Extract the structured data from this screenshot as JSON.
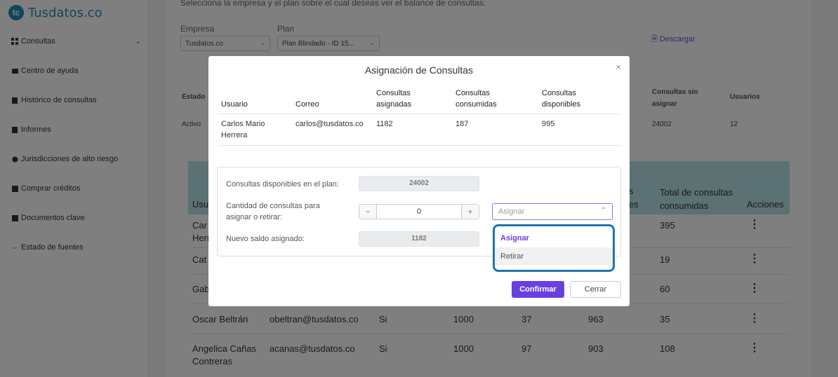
{
  "brand": {
    "name": "Tusdatos.co",
    "mark": "tc"
  },
  "sidebar": {
    "items": [
      {
        "label": "Consultas",
        "icon": "grid-icon"
      },
      {
        "label": "Centro de ayuda",
        "icon": "help-icon"
      },
      {
        "label": "Histórico de consultas",
        "icon": "history-icon"
      },
      {
        "label": "Informes",
        "icon": "report-icon"
      },
      {
        "label": "Jurisdicciones de alto riesgo",
        "icon": "globe-icon"
      },
      {
        "label": "Comprar créditos",
        "icon": "cart-icon"
      },
      {
        "label": "Documentos clave",
        "icon": "documents-icon"
      },
      {
        "label": "Estado de fuentes",
        "icon": "status-icon"
      }
    ]
  },
  "main": {
    "intro": "Selecciona la empresa y el plan sobre el cual deseas ver el balance de consultas:",
    "empresa_label": "Empresa",
    "empresa_value": "Tusdatos.co",
    "plan_label": "Plan",
    "plan_value": "Plan Blindado - ID 15...",
    "download": "Descargar",
    "summary_headers": {
      "estado": "Estado",
      "sin_asignar": "Consultas sin asignar",
      "usuarios": "Usuarios"
    },
    "summary_row": {
      "estado": "Activo",
      "sin_asignar": "24002",
      "usuarios": "12"
    },
    "table_headers": {
      "usuario": "Usu",
      "disponibles_tail": "s",
      "disponibles_tail2": "es",
      "total": "Total de consultas consumidas",
      "acciones": "Acciones"
    },
    "rows": [
      {
        "usuario": "Car",
        "usuario2": "Herr",
        "total": "395"
      },
      {
        "usuario": "Cat",
        "total": "19"
      },
      {
        "usuario": "Gab",
        "total": "60"
      },
      {
        "usuario": "Oscar Beltrán",
        "correo": "obeltran@tusdatos.co",
        "si": "Si",
        "asignadas": "1000",
        "consumidas": "37",
        "disponibles": "963",
        "total": "35"
      },
      {
        "usuario": "Angelica Cañas",
        "usuario2": "Contreras",
        "correo": "acanas@tusdatos.co",
        "si": "Si",
        "asignadas": "1000",
        "consumidas": "97",
        "disponibles": "903",
        "total": "108"
      }
    ]
  },
  "modal": {
    "title": "Asignación de Consultas",
    "close": "×",
    "headers": {
      "usuario": "Usuario",
      "correo": "Correo",
      "asignadas_1": "Consultas",
      "asignadas_2": "asignadas",
      "consumidas_1": "Consultas",
      "consumidas_2": "consumidas",
      "disponibles_1": "Consultas",
      "disponibles_2": "disponibles"
    },
    "row": {
      "usuario_1": "Carlos Mario",
      "usuario_2": "Herrera",
      "correo": "carlos@tusdatos.co",
      "asignadas": "1182",
      "consumidas": "187",
      "disponibles": "995"
    },
    "panel": {
      "plan_label": "Consultas disponibles en el plan:",
      "plan_value": "24002",
      "cantidad_label_1": "Cantidad de consultas para",
      "cantidad_label_2": "asignar o retirar:",
      "cantidad_value": "0",
      "minus": "−",
      "plus": "+",
      "nuevo_label": "Nuevo saldo asignado:",
      "nuevo_value": "1182",
      "dropdown_placeholder": "Asignar",
      "options": [
        "Asignar",
        "Retirar"
      ]
    },
    "confirm": "Confirmar",
    "cancel": "Cerrar"
  }
}
